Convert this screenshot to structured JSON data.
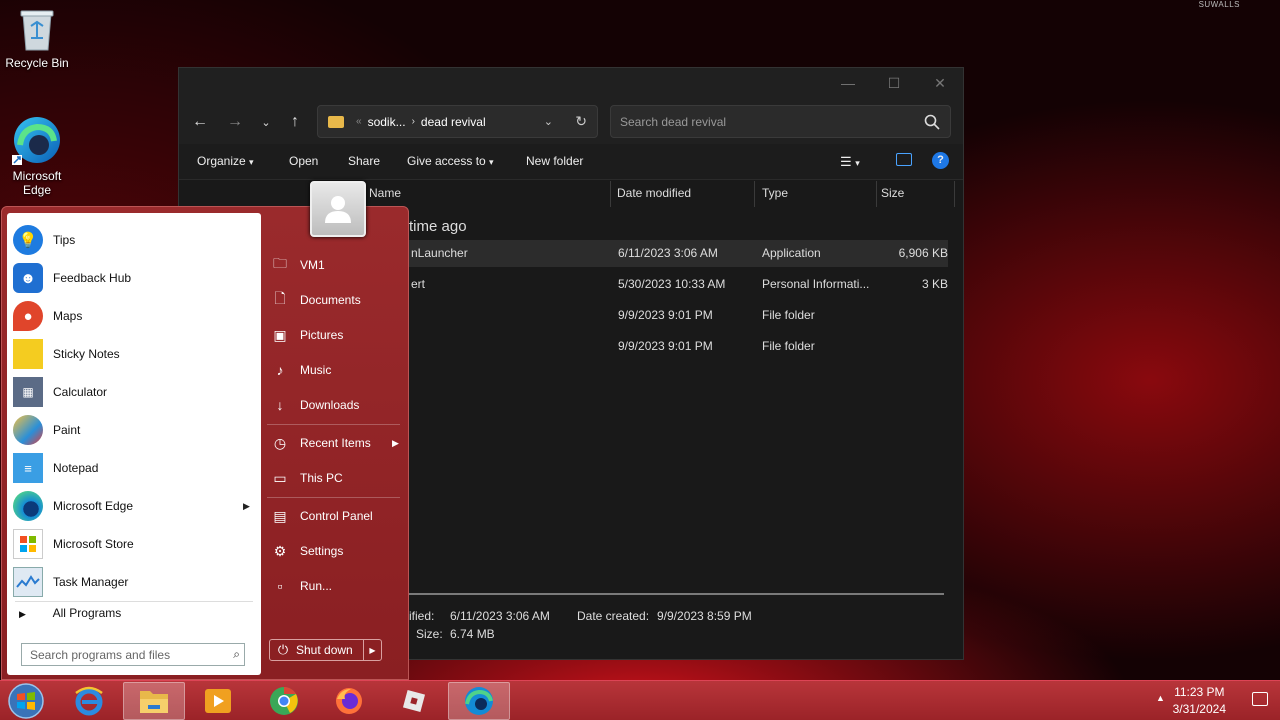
{
  "watermark": "SUWALLS",
  "desktop": {
    "recycle_bin": "Recycle Bin",
    "edge": "Microsoft Edge"
  },
  "explorer": {
    "controls": {
      "minimize": "—",
      "maximize": "☐",
      "close": "✕"
    },
    "address": {
      "parent": "sodik...",
      "current": "dead revival"
    },
    "search_placeholder": "Search dead revival",
    "commands": [
      "Organize",
      "Open",
      "Share",
      "Give access to",
      "New folder"
    ],
    "columns": [
      "Name",
      "Date modified",
      "Type",
      "Size"
    ],
    "group_label": "time ago",
    "rows": [
      {
        "name": "nLauncher",
        "date": "6/11/2023 3:06 AM",
        "type": "Application",
        "size": "6,906 KB"
      },
      {
        "name": "ert",
        "date": "5/30/2023 10:33 AM",
        "type": "Personal Informati...",
        "size": "3 KB"
      },
      {
        "name": "",
        "date": "9/9/2023 9:01 PM",
        "type": "File folder",
        "size": ""
      },
      {
        "name": "",
        "date": "9/9/2023 9:01 PM",
        "type": "File folder",
        "size": ""
      }
    ],
    "details": {
      "modified_label": "ified:",
      "modified_value": "6/11/2023 3:06 AM",
      "created_label": "Date created:",
      "created_value": "9/9/2023 8:59 PM",
      "size_label": "Size:",
      "size_value": "6.74 MB"
    }
  },
  "start_menu": {
    "apps": [
      {
        "label": "Tips",
        "icon": "tips-icon",
        "color": "#1e7be0"
      },
      {
        "label": "Feedback Hub",
        "icon": "feedback-hub-icon",
        "color": "#1f6fd1"
      },
      {
        "label": "Maps",
        "icon": "maps-icon",
        "color": "#e0452b"
      },
      {
        "label": "Sticky Notes",
        "icon": "sticky-notes-icon",
        "color": "#f4cc20"
      },
      {
        "label": "Calculator",
        "icon": "calculator-icon",
        "color": "#5b6b86"
      },
      {
        "label": "Paint",
        "icon": "paint-icon",
        "color": "#2a8fd8"
      },
      {
        "label": "Notepad",
        "icon": "notepad-icon",
        "color": "#3a9ee4"
      },
      {
        "label": "Microsoft Edge",
        "icon": "edge-icon",
        "color": "#138bd6"
      },
      {
        "label": "Microsoft Store",
        "icon": "store-icon",
        "color": "#e44a2a"
      },
      {
        "label": "Task Manager",
        "icon": "task-manager-icon",
        "color": "#4c8ac7"
      }
    ],
    "all_programs": "All Programs",
    "search_placeholder": "Search programs and files",
    "right_items": [
      {
        "label": "VM1",
        "icon": "user-folder-icon"
      },
      {
        "label": "Documents",
        "icon": "documents-icon"
      },
      {
        "label": "Pictures",
        "icon": "pictures-icon"
      },
      {
        "label": "Music",
        "icon": "music-icon"
      },
      {
        "label": "Downloads",
        "icon": "downloads-icon"
      },
      {
        "label": "Recent Items",
        "icon": "clock-icon"
      },
      {
        "label": "This PC",
        "icon": "computer-icon"
      },
      {
        "label": "Control Panel",
        "icon": "control-panel-icon"
      },
      {
        "label": "Settings",
        "icon": "gear-icon"
      },
      {
        "label": "Run...",
        "icon": "run-icon"
      }
    ],
    "shutdown": "Shut down"
  },
  "taskbar": {
    "time": "11:23 PM",
    "date": "3/31/2024"
  }
}
